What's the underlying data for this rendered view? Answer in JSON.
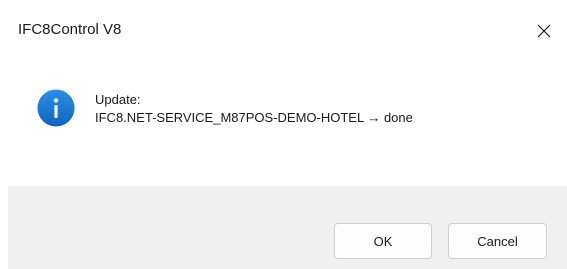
{
  "window": {
    "title": "IFC8Control V8"
  },
  "message": {
    "line1": "Update:",
    "line2": "IFC8.NET-SERVICE_M87POS-DEMO-HOTEL → done"
  },
  "buttons": {
    "ok_label": "OK",
    "cancel_label": "Cancel"
  },
  "icons": {
    "info": "info-icon",
    "close": "close-icon"
  },
  "colors": {
    "info_blue": "#1479d4",
    "footer_bg": "#f0f0f0"
  }
}
